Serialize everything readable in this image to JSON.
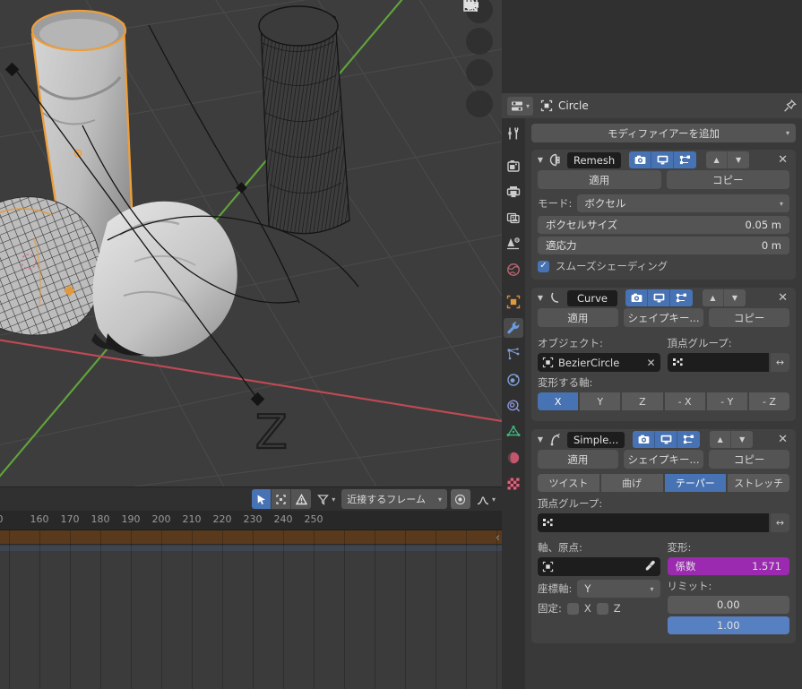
{
  "viewport": {
    "gizmos": [
      {
        "name": "zoom-icon"
      },
      {
        "name": "hand-icon"
      },
      {
        "name": "camera-icon"
      },
      {
        "name": "grid-icon"
      }
    ],
    "axis_label_z": "Z"
  },
  "timeline": {
    "header": {
      "select_tool": "cursor-select-icon",
      "box_select": "box-select-icon",
      "warning": "warning-icon",
      "filter": "filter-icon",
      "snap_mode": "近接するフレーム",
      "proportional": "proportional-edit-icon",
      "falloff": "falloff-curve-icon"
    },
    "ruler_ticks": [
      "0",
      "160",
      "170",
      "180",
      "190",
      "200",
      "210",
      "220",
      "230",
      "240",
      "250"
    ],
    "collapse_arrow": "‹"
  },
  "properties": {
    "header": {
      "editor_type_icon": "properties-editor-icon",
      "object_icon": "object-data-icon",
      "object_name": "Circle",
      "pin_icon": "pin-icon"
    },
    "tabs": [
      {
        "name": "tool",
        "icon": "tool-icon",
        "selected": false
      },
      {
        "name": "render",
        "icon": "camera-back-icon",
        "selected": false
      },
      {
        "name": "output",
        "icon": "printer-icon",
        "selected": false
      },
      {
        "name": "view-layer",
        "icon": "images-icon",
        "selected": false
      },
      {
        "name": "scene",
        "icon": "scene-cone-icon",
        "selected": false
      },
      {
        "name": "world",
        "icon": "world-icon",
        "selected": false
      },
      {
        "name": "object",
        "icon": "object-square-icon",
        "selected": false
      },
      {
        "name": "modifiers",
        "icon": "wrench-icon",
        "selected": true
      },
      {
        "name": "particles",
        "icon": "particles-icon",
        "selected": false
      },
      {
        "name": "physics",
        "icon": "physics-orbit-icon",
        "selected": false
      },
      {
        "name": "constraints",
        "icon": "constraint-icon",
        "selected": false
      },
      {
        "name": "object-data",
        "icon": "mesh-data-triangle-icon",
        "selected": false
      },
      {
        "name": "material",
        "icon": "material-sphere-icon",
        "selected": false
      },
      {
        "name": "texture",
        "icon": "texture-checker-icon",
        "selected": false
      }
    ],
    "add_modifier": "モディファイアーを追加",
    "modifiers": [
      {
        "id": "remesh",
        "icon": "remesh-icon",
        "name": "Remesh",
        "toggles": [
          "render-toggle-icon",
          "realtime-toggle-icon",
          "editmode-toggle-icon"
        ],
        "move_up": "▲",
        "move_down": "▼",
        "close": "✕",
        "buttons": [
          "適用",
          "コピー"
        ],
        "mode_label": "モード:",
        "mode_value": "ボクセル",
        "voxel_size_label": "ボクセルサイズ",
        "voxel_size_value": "0.05 m",
        "adaptivity_label": "適応力",
        "adaptivity_value": "0 m",
        "smooth_shading_label": "スムーズシェーディング",
        "smooth_shading_checked": true
      },
      {
        "id": "curve",
        "icon": "curve-icon",
        "name": "Curve",
        "toggles": [
          "render-toggle-icon",
          "realtime-toggle-icon",
          "editmode-toggle-icon"
        ],
        "move_up": "▲",
        "move_down": "▼",
        "close": "✕",
        "buttons": [
          "適用",
          "シェイプキー...",
          "コピー"
        ],
        "object_label": "オブジェクト:",
        "object_value": "BezierCircle",
        "vertex_group_label": "頂点グループ:",
        "vertex_group_value": "",
        "deform_axis_label": "変形する軸:",
        "deform_axis_options": [
          "X",
          "Y",
          "Z",
          "- X",
          "- Y",
          "- Z"
        ],
        "deform_axis_selected": "X"
      },
      {
        "id": "simple-deform",
        "icon": "simple-deform-icon",
        "name": "Simple...",
        "toggles": [
          "render-toggle-icon",
          "realtime-toggle-icon",
          "editmode-toggle-icon"
        ],
        "move_up": "▲",
        "move_down": "▼",
        "close": "✕",
        "buttons": [
          "適用",
          "シェイプキー...",
          "コピー"
        ],
        "method_options": [
          "ツイスト",
          "曲げ",
          "テーパー",
          "ストレッチ"
        ],
        "method_selected": "テーパー",
        "vertex_group_label": "頂点グループ:",
        "vertex_group_value": "",
        "origin_label": "軸、原点:",
        "origin_value": "",
        "axis_label": "座標軸:",
        "axis_value": "Y",
        "lock_label": "固定:",
        "lock_x": "X",
        "lock_z": "Z",
        "deform_label": "変形:",
        "factor_label": "係数",
        "factor_value": "1.571",
        "limits_label": "リミット:",
        "limit_low": "0.00",
        "limit_high": "1.00"
      }
    ]
  },
  "colors": {
    "accent_blue": "#4772b3",
    "accent_magenta": "#9b2ab0",
    "value_blue": "#5680c2",
    "panel_bg": "#393939",
    "modifier_bg": "#424242",
    "selection_orange": "#ed9e3c",
    "axis_red": "#c04a55",
    "axis_green": "#61a53b",
    "timeline_channel": "#593a1c"
  }
}
